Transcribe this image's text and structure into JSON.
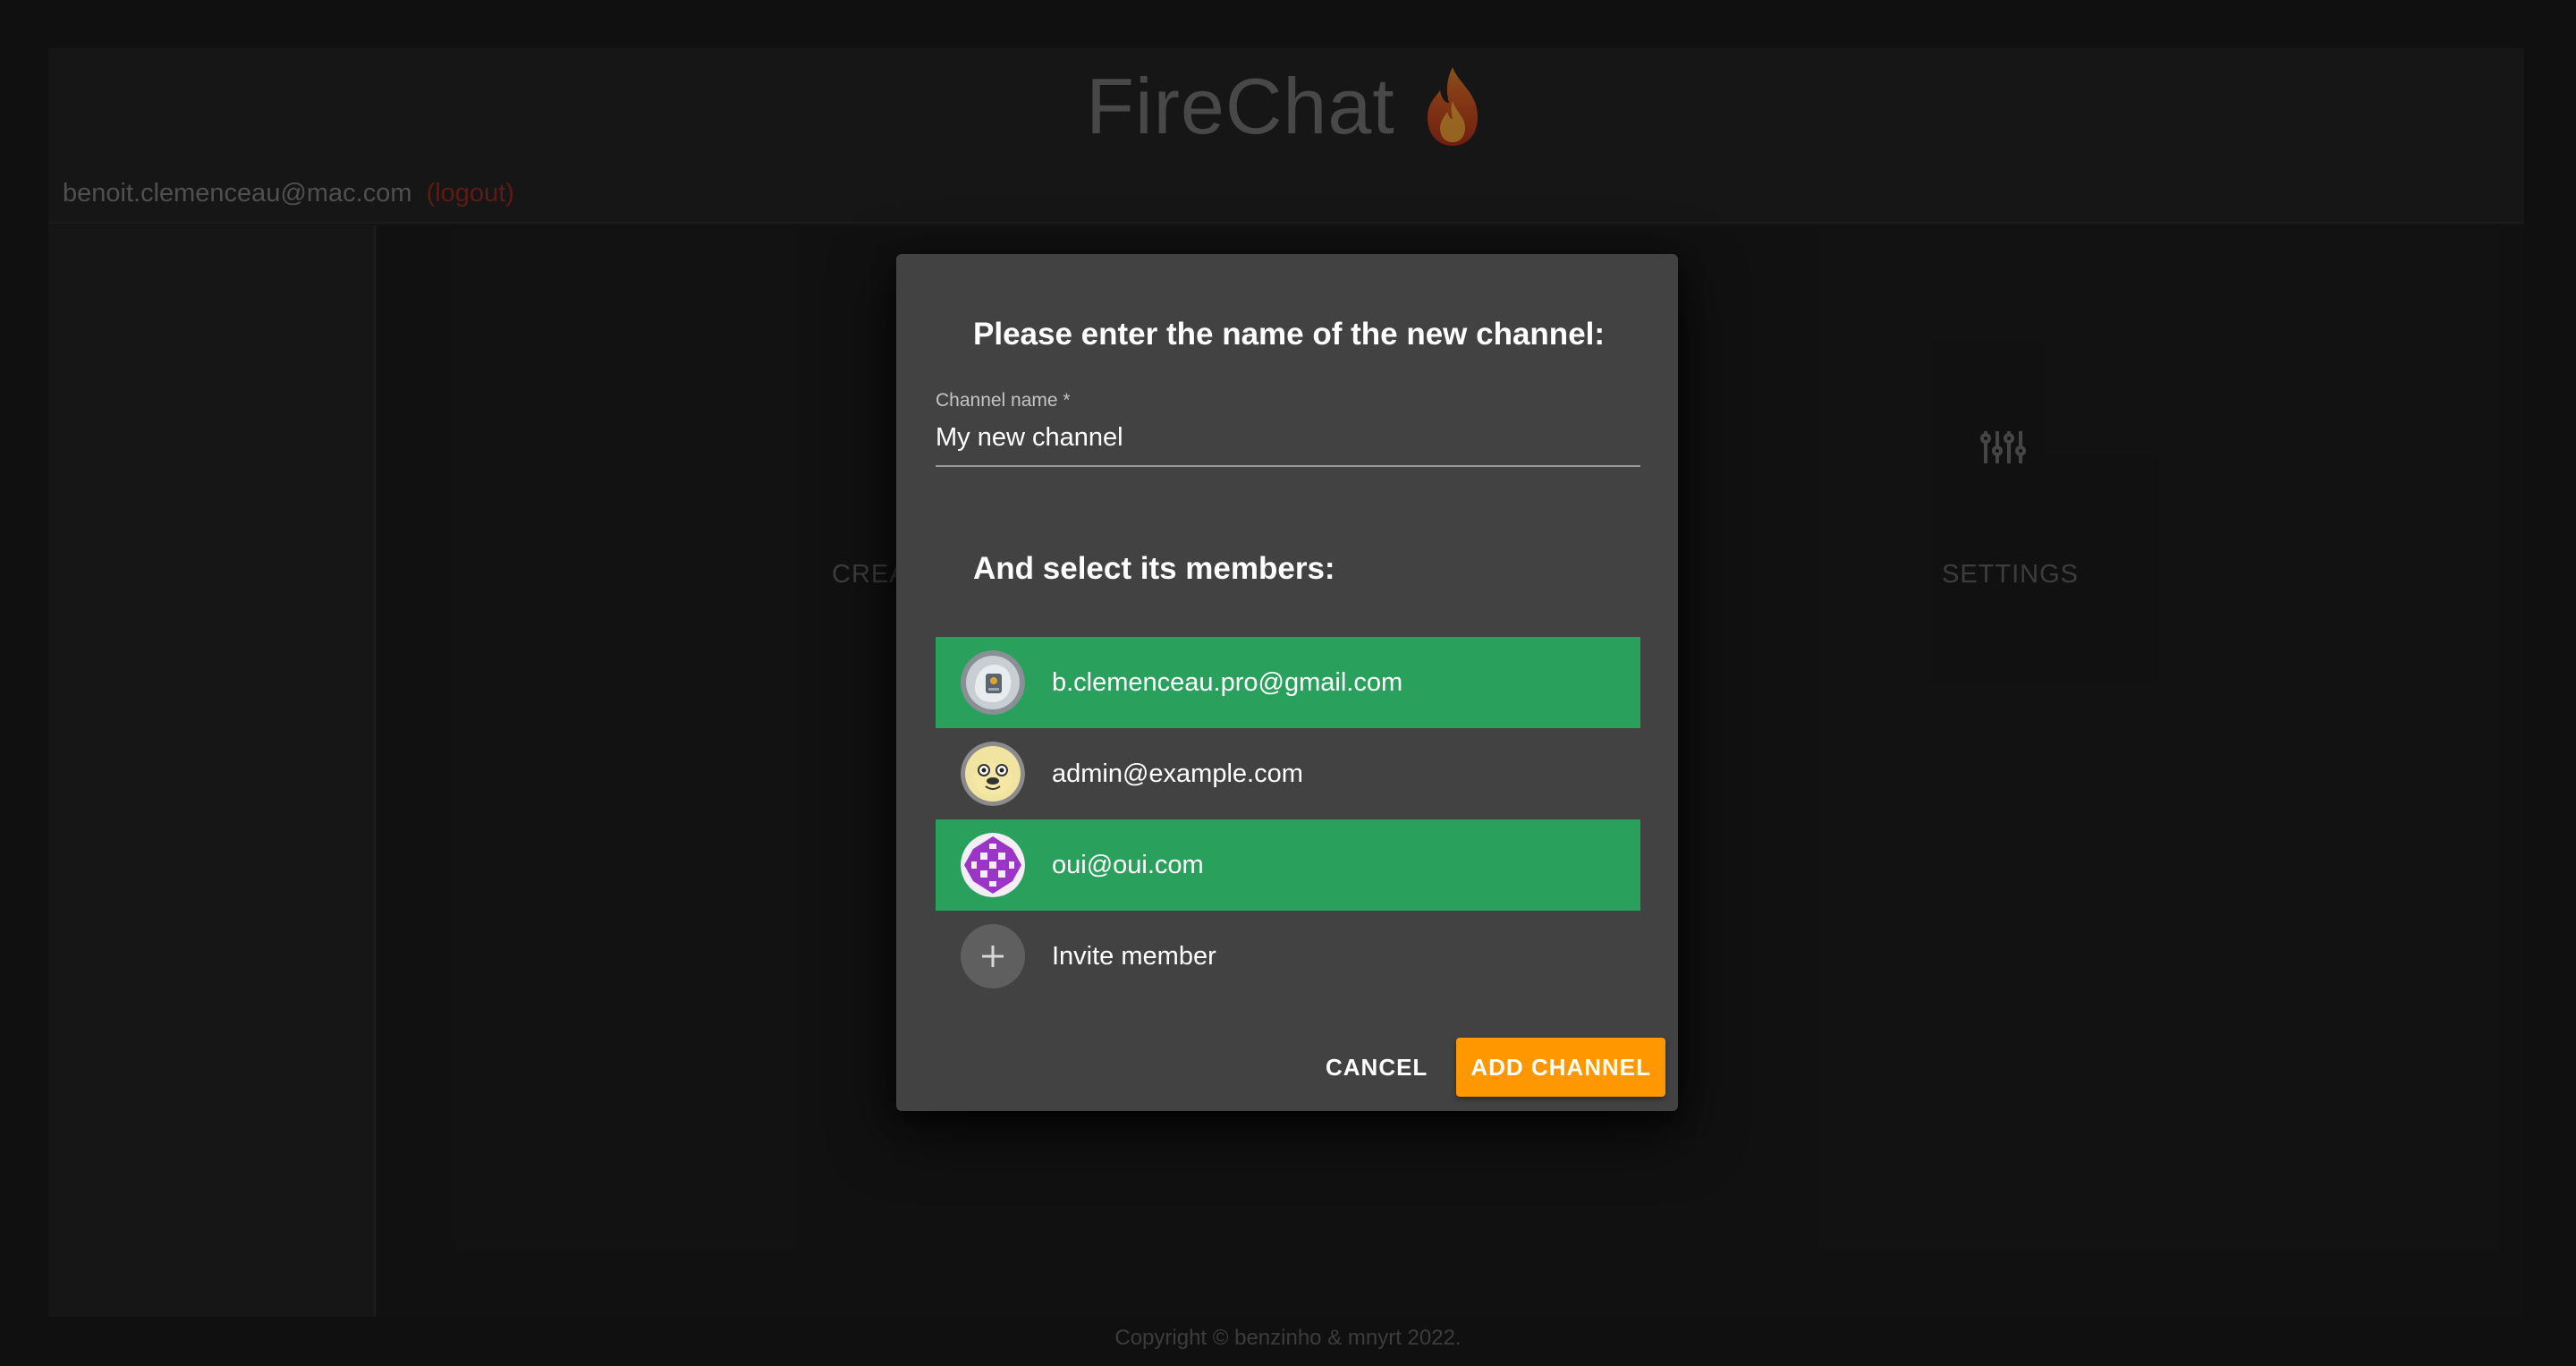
{
  "app": {
    "title": "FireChat",
    "user_email": "benoit.clemenceau@mac.com",
    "logout_label": "(logout)"
  },
  "main": {
    "tiles": [
      {
        "label": "CREATE C",
        "icon": "network-icon"
      },
      {
        "label": "SETTINGS",
        "icon": "sliders-icon"
      }
    ]
  },
  "dialog": {
    "title": "Please enter the name of the new channel:",
    "channel_field": {
      "label": "Channel name *",
      "value": "My new channel"
    },
    "members_title": "And select its members:",
    "members": [
      {
        "email": "b.clemenceau.pro@gmail.com",
        "selected": true
      },
      {
        "email": "admin@example.com",
        "selected": false
      },
      {
        "email": "oui@oui.com",
        "selected": true
      }
    ],
    "invite_label": "Invite member",
    "cancel_label": "CANCEL",
    "add_label": "ADD CHANNEL"
  },
  "colors": {
    "selected_row": "#2aa05d",
    "accent": "#ff9800",
    "dialog_bg": "#424242",
    "logout": "#8c2a22"
  },
  "footer": {
    "text": "Copyright © benzinho & mnyrt 2022."
  }
}
